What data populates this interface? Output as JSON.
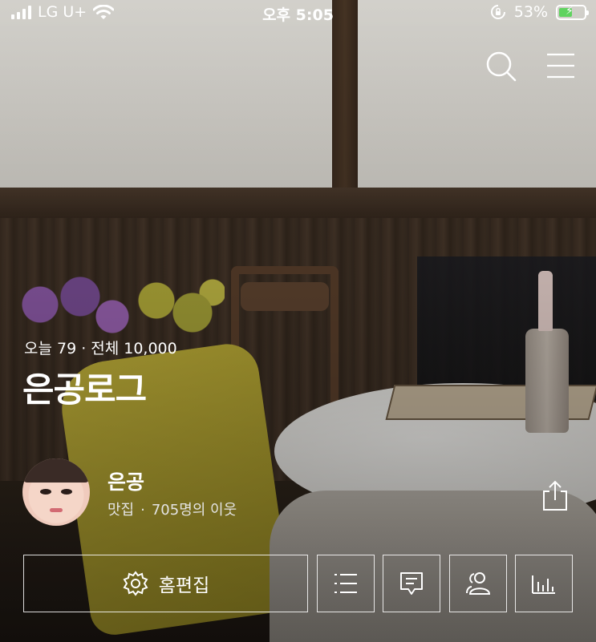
{
  "status_bar": {
    "carrier": "LG U+",
    "time": "오후 5:05",
    "battery_percent": "53%",
    "battery_level": 0.53
  },
  "icons": {
    "search": "search-icon",
    "menu": "hamburger-menu-icon",
    "share": "share-icon",
    "settings": "gear-icon",
    "list": "list-icon",
    "comment": "comment-icon",
    "neighbors": "people-icon",
    "stats": "bar-chart-icon"
  },
  "blog": {
    "visitors_today": "오늘 79",
    "visitors_separator": "·",
    "visitors_total": "전체 10,000",
    "title": "은공로그"
  },
  "profile": {
    "nickname": "은공",
    "category": "맛집",
    "separator": "·",
    "neighbors": "705명의 이웃"
  },
  "actions": {
    "edit_home_label": "홈편집"
  },
  "colors": {
    "text": "#ffffff",
    "battery_fill": "#5fd35f"
  }
}
